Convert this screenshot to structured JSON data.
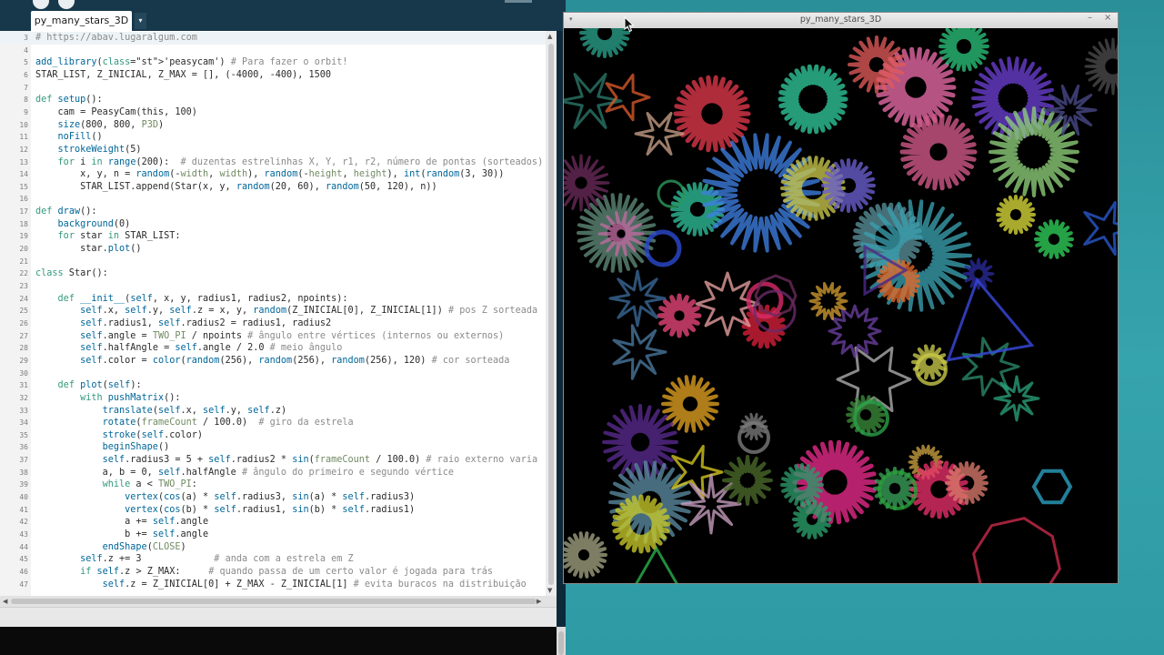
{
  "ide": {
    "tab_label": "py_many_stars_3D",
    "tab_menu_glyph": "▾",
    "line_numbers": [
      "3",
      "4",
      "5",
      "6",
      "7",
      "8",
      "9",
      "10",
      "11",
      "12",
      "13",
      "14",
      "15",
      "16",
      "17",
      "18",
      "19",
      "20",
      "21",
      "22",
      "23",
      "24",
      "25",
      "26",
      "27",
      "28",
      "29",
      "30",
      "31",
      "32",
      "33",
      "34",
      "35",
      "36",
      "37",
      "38",
      "39",
      "40",
      "41",
      "42",
      "43",
      "44",
      "45",
      "46",
      "47"
    ],
    "code_lines": [
      "# https://abav.lugaralgum.com",
      "",
      "add_library('peasycam') # Para fazer o orbit!",
      "STAR_LIST, Z_INICIAL, Z_MAX = [], (-4000, -400), 1500",
      "",
      "def setup():",
      "    cam = PeasyCam(this, 100)",
      "    size(800, 800, P3D)",
      "    noFill()",
      "    strokeWeight(5)",
      "    for i in range(200):  # duzentas estrelinhas X, Y, r1, r2, número de pontas (sorteados)",
      "        x, y, n = random(-width, width), random(-height, height), int(random(3, 30))",
      "        STAR_LIST.append(Star(x, y, random(20, 60), random(50, 120), n))",
      "",
      "def draw():",
      "    background(0)",
      "    for star in STAR_LIST:",
      "        star.plot()",
      "",
      "class Star():",
      "",
      "    def __init__(self, x, y, radius1, radius2, npoints):",
      "        self.x, self.y, self.z = x, y, random(Z_INICIAL[0], Z_INICIAL[1]) # pos Z sorteada",
      "        self.radius1, self.radius2 = radius1, radius2",
      "        self.angle = TWO_PI / npoints # ângulo entre vértices (internos ou externos)",
      "        self.halfAngle = self.angle / 2.0 # meio ângulo",
      "        self.color = color(random(256), random(256), random(256), 120) # cor sorteada",
      "",
      "    def plot(self):",
      "        with pushMatrix():",
      "            translate(self.x, self.y, self.z)",
      "            rotate(frameCount / 100.0)  # giro da estrela",
      "            stroke(self.color)",
      "            beginShape()",
      "            self.radius3 = 5 + self.radius2 * sin(frameCount / 100.0) # raio externo varia",
      "            a, b = 0, self.halfAngle # ângulo do primeiro e segundo vértice",
      "            while a < TWO_PI:",
      "                vertex(cos(a) * self.radius3, sin(a) * self.radius3)",
      "                vertex(cos(b) * self.radius1, sin(b) * self.radius1)",
      "                a += self.angle",
      "                b += self.angle",
      "            endShape(CLOSE)",
      "        self.z += 3             # anda com a estrela em Z",
      "        if self.z > Z_MAX:     # quando passa de um certo valor é jogada para trás",
      "            self.z = Z_INICIAL[0] + Z_MAX - Z_INICIAL[1] # evita buracos na distribuição"
    ]
  },
  "sketch": {
    "title": "py_many_stars_3D",
    "menu_glyph": "▾",
    "minimize_glyph": "–",
    "close_glyph": "×"
  },
  "colors": {
    "ide_dark": "#0e2a3a",
    "keyword": "#33997e",
    "function": "#006699",
    "comment": "#8a8a8a",
    "string": "#7d4793"
  }
}
